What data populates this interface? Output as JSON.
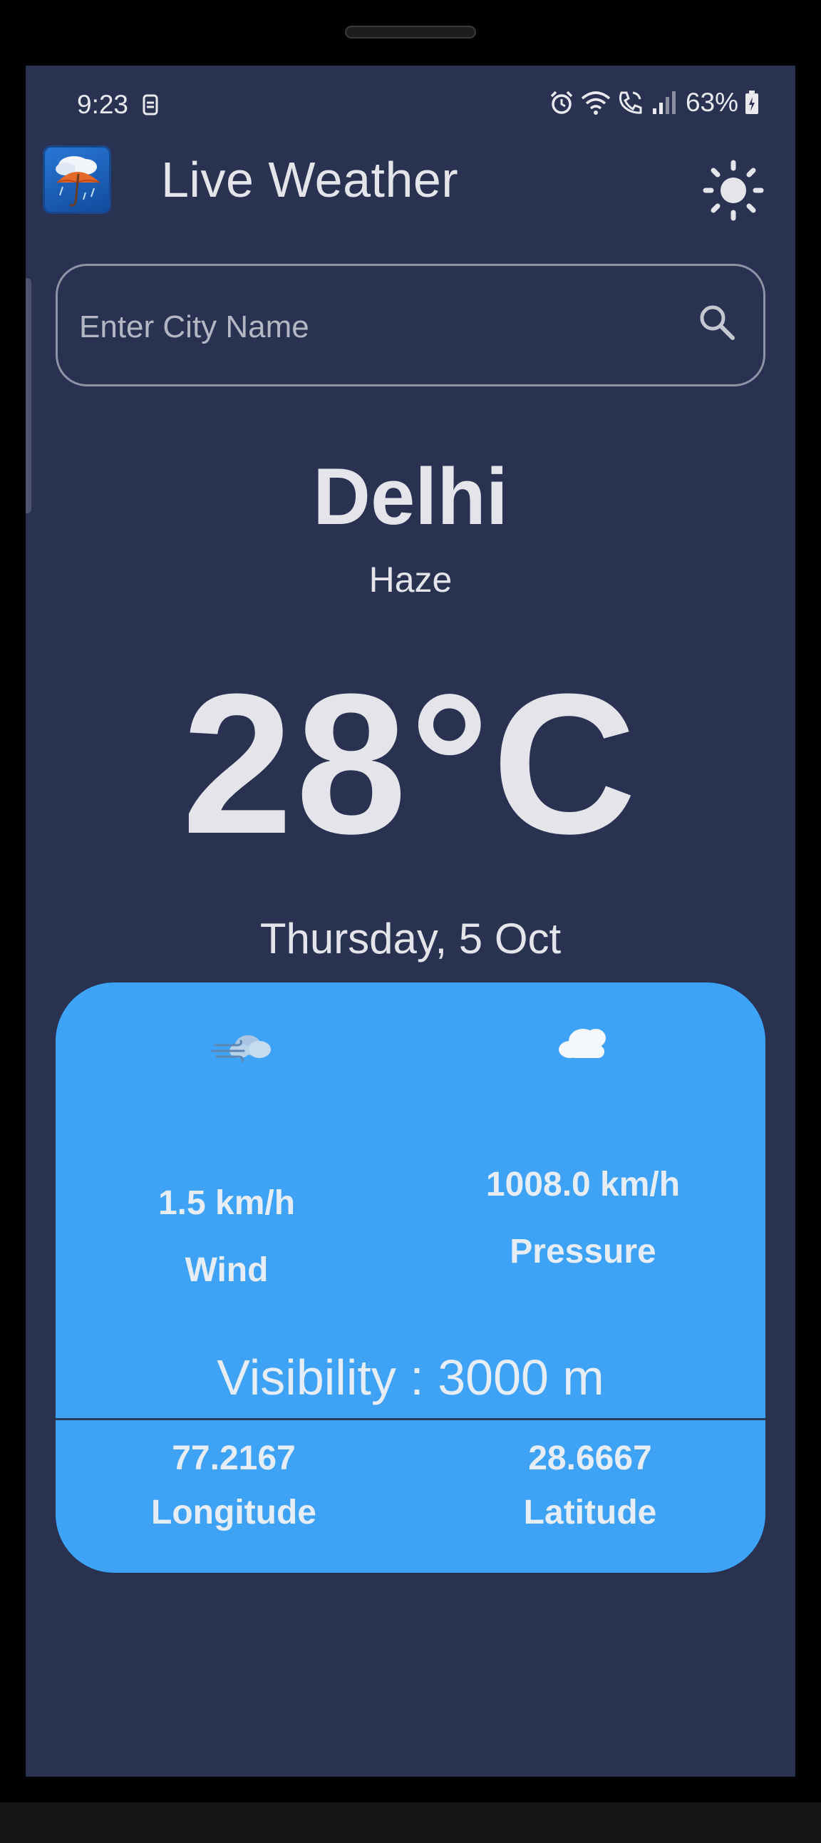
{
  "status_bar": {
    "time": "9:23",
    "battery": "63%",
    "icons": [
      "sim-icon",
      "alarm-icon",
      "wifi-icon",
      "call-icon",
      "signal-icon",
      "battery-icon"
    ]
  },
  "app_bar": {
    "title": "Live Weather",
    "logo_icon": "weather-umbrella-logo-icon",
    "theme_toggle_icon": "sun-icon"
  },
  "search": {
    "placeholder": "Enter City Name",
    "value": "",
    "icon": "search-icon"
  },
  "weather": {
    "city": "Delhi",
    "condition": "Haze",
    "temperature": "28°C",
    "date": "Thursday, 5 Oct"
  },
  "details": {
    "wind": {
      "value": "1.5 km/h",
      "label": "Wind",
      "icon": "wind-icon"
    },
    "pressure": {
      "value": "1008.0 km/h",
      "label": "Pressure",
      "icon": "cloud-icon"
    },
    "visibility": "Visibility : 3000 m",
    "longitude": {
      "value": "77.2167",
      "label": "Longitude"
    },
    "latitude": {
      "value": "28.6667",
      "label": "Latitude"
    }
  },
  "colors": {
    "background": "#293251",
    "card": "#3ea2f6",
    "text": "#e4e4ea"
  }
}
